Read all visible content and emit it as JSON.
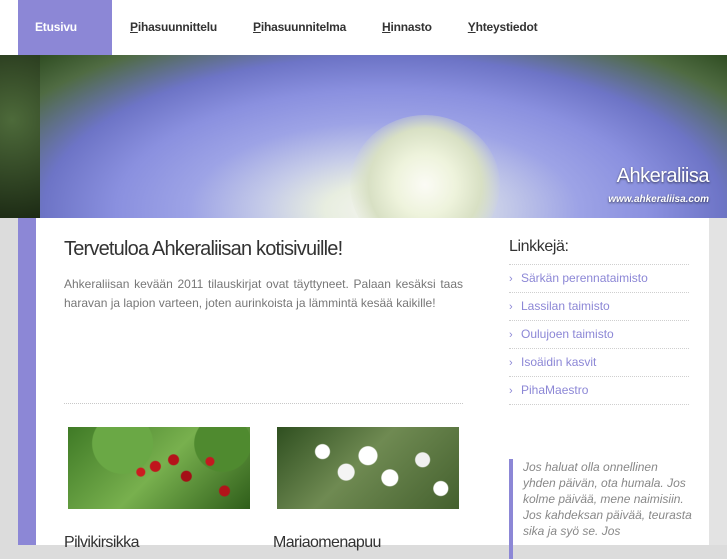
{
  "nav": {
    "items": [
      {
        "label": "Etusivu",
        "first": "",
        "rest": "Etusivu"
      },
      {
        "label": "Pihasuunnittelu",
        "first": "P",
        "rest": "ihasuunnittelu"
      },
      {
        "label": "Pihasuunnitelma",
        "first": "P",
        "rest": "ihasuunnitelma"
      },
      {
        "label": "Hinnasto",
        "first": "H",
        "rest": "innasto"
      },
      {
        "label": "Yhteystiedot",
        "first": "Y",
        "rest": "hteystiedot"
      }
    ]
  },
  "banner": {
    "title": "Ahkeraliisa",
    "url": "www.ahkeraliisa.com"
  },
  "main": {
    "title": "Tervetuloa Ahkeraliisan kotisivuille!",
    "intro": "Ahkeraliisan kevään 2011 tilauskirjat ovat täyttyneet. Palaan kesäksi taas haravan ja lapion varteen, joten aurinkoista ja lämmintä kesää kaikille!",
    "thumbs": [
      {
        "caption": "Pilvikirsikka"
      },
      {
        "caption": "Mariaomenapuu"
      }
    ]
  },
  "sidebar": {
    "title": "Linkkejä:",
    "links": [
      "Särkän perennataimisto",
      "Lassilan taimisto",
      "Oulujoen taimisto",
      "Isoäidin kasvit",
      "PihaMaestro"
    ],
    "quote": "Jos haluat olla onnellinen yhden päivän, ota humala. Jos kolme päivää, mene naimisiin. Jos kahdeksan päivää, teurasta sika ja syö se. Jos"
  },
  "colors": {
    "accent": "#8c87d6",
    "text": "#333333",
    "muted": "#777777"
  }
}
